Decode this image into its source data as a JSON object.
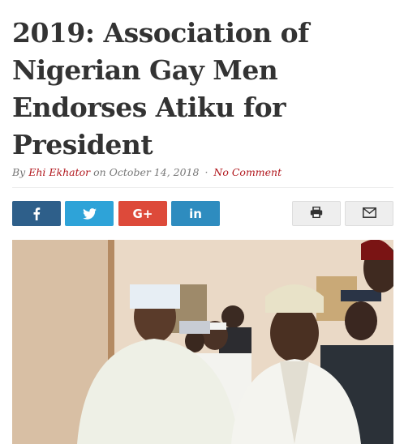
{
  "article": {
    "title": "2019: Association of Nigerian Gay Men Endorses Atiku for President",
    "byline": {
      "by": "By",
      "author": "Ehi Ekhator",
      "on": "on",
      "date": "October 14, 2018",
      "separator": "·",
      "comments": "No Comment"
    }
  },
  "share": {
    "buttons": [
      {
        "network": "facebook",
        "icon": "facebook-icon",
        "color": "#2e5f8a"
      },
      {
        "network": "twitter",
        "icon": "twitter-icon",
        "color": "#2ea3d8"
      },
      {
        "network": "google-plus",
        "icon": "google-plus-icon",
        "label": "G+",
        "color": "#dd4a3a"
      },
      {
        "network": "linkedin",
        "icon": "linkedin-icon",
        "label": "in",
        "color": "#2e8cbf"
      }
    ],
    "utility": [
      {
        "action": "print",
        "icon": "printer-icon"
      },
      {
        "action": "email",
        "icon": "envelope-icon"
      }
    ]
  },
  "colors": {
    "title": "#333333",
    "accent": "#b1161c",
    "meta": "#777777"
  }
}
